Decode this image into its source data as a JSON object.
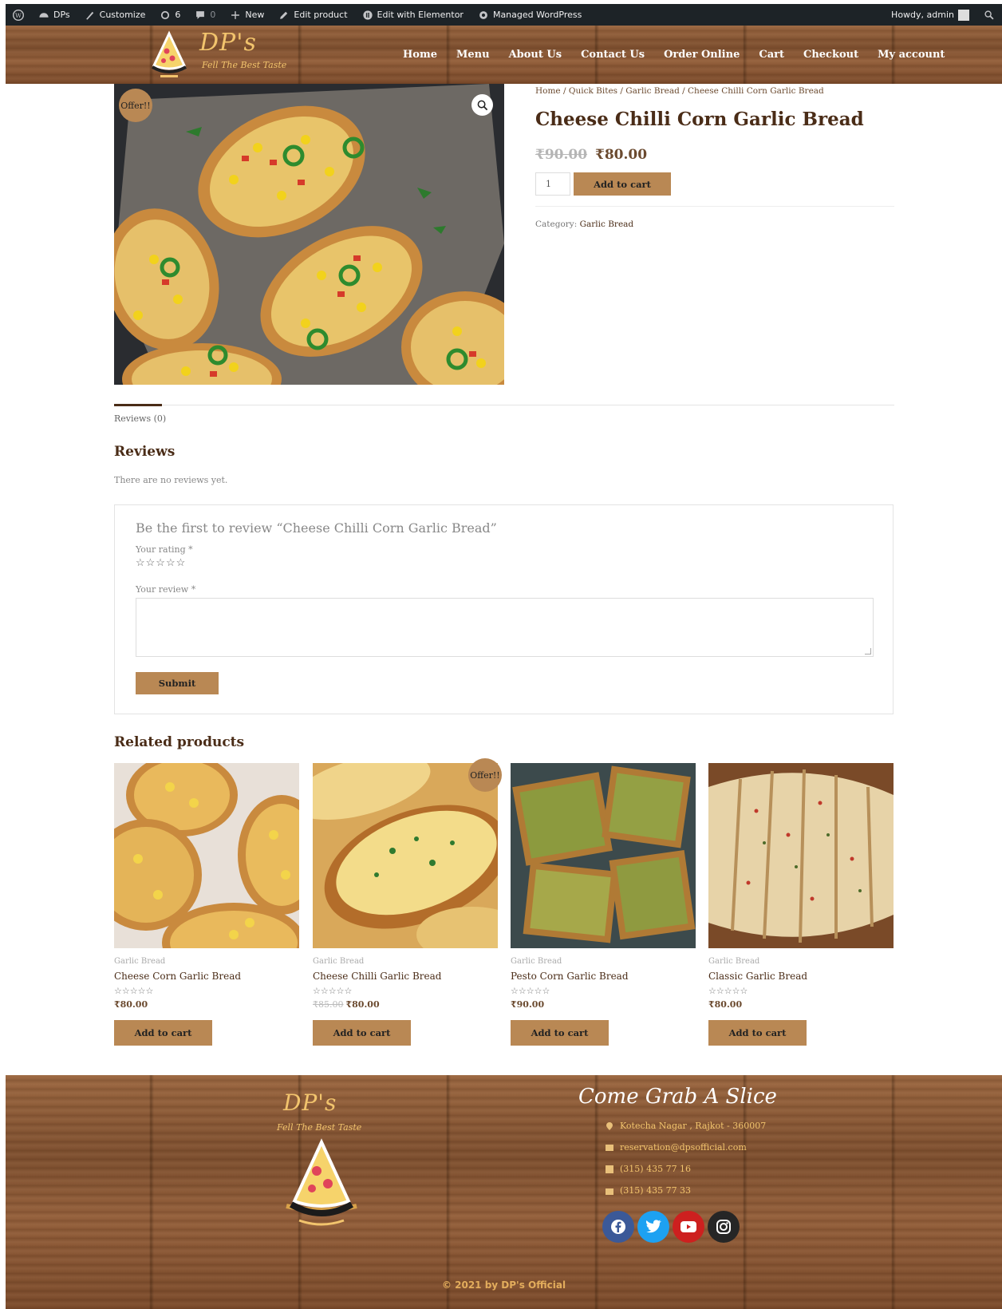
{
  "admin_bar": {
    "site_name": "DPs",
    "customize": "Customize",
    "updates_count": "6",
    "comments_count": "0",
    "new": "New",
    "edit_product": "Edit product",
    "edit_elementor": "Edit with Elementor",
    "managed_wp": "Managed WordPress",
    "howdy": "Howdy, admin"
  },
  "header": {
    "brand": "DP's",
    "tagline": "Fell The Best Taste",
    "nav": [
      "Home",
      "Menu",
      "About Us",
      "Contact Us",
      "Order Online",
      "Cart",
      "Checkout",
      "My account"
    ]
  },
  "product": {
    "badge": "Offer!!",
    "breadcrumb": "Home / Quick Bites / Garlic Bread / Cheese Chilli Corn Garlic Bread",
    "title": "Cheese Chilli Corn Garlic Bread",
    "old_price": "₹90.00",
    "price": "₹80.00",
    "quantity": "1",
    "add_to_cart": "Add to cart",
    "category_label": "Category:",
    "category_value": "Garlic Bread"
  },
  "tabs": {
    "reviews_tab": "Reviews (0)"
  },
  "reviews": {
    "heading": "Reviews",
    "empty_text": "There are no reviews yet.",
    "reply_title": "Be the first to review “Cheese Chilli Corn Garlic Bread”",
    "rating_label": "Your rating *",
    "rating_stars": "☆☆☆☆☆",
    "review_label": "Your review *",
    "submit": "Submit"
  },
  "related": {
    "heading": "Related products",
    "items": [
      {
        "category": "Garlic Bread",
        "name": "Cheese Corn Garlic Bread",
        "stars": "☆☆☆☆☆",
        "old_price": "",
        "price": "₹80.00",
        "button": "Add to cart",
        "badge": ""
      },
      {
        "category": "Garlic Bread",
        "name": "Cheese Chilli Garlic Bread",
        "stars": "☆☆☆☆☆",
        "old_price": "₹85.00",
        "price": "₹80.00",
        "button": "Add to cart",
        "badge": "Offer!!"
      },
      {
        "category": "Garlic Bread",
        "name": "Pesto Corn Garlic Bread",
        "stars": "☆☆☆☆☆",
        "old_price": "",
        "price": "₹90.00",
        "button": "Add to cart",
        "badge": ""
      },
      {
        "category": "Garlic Bread",
        "name": "Classic Garlic Bread",
        "stars": "☆☆☆☆☆",
        "old_price": "",
        "price": "₹80.00",
        "button": "Add to cart",
        "badge": ""
      }
    ]
  },
  "footer": {
    "brand": "DP's",
    "tagline": "Fell The Best Taste",
    "slogan": "Come Grab A Slice",
    "address": "Kotecha Nagar , Rajkot - 360007",
    "email": "reservation@dpsofficial.com",
    "phone1": "(315) 435 77 16",
    "phone2": "(315) 435 77 33",
    "copyright": "© 2021 by DP's Official",
    "social_icons": [
      "facebook-icon",
      "twitter-icon",
      "youtube-icon",
      "instagram-icon"
    ]
  },
  "colors": {
    "accent": "#b98854",
    "heading": "#4a2c17",
    "footer_gold": "#f2c46d",
    "admin_bar": "#1d2327"
  }
}
